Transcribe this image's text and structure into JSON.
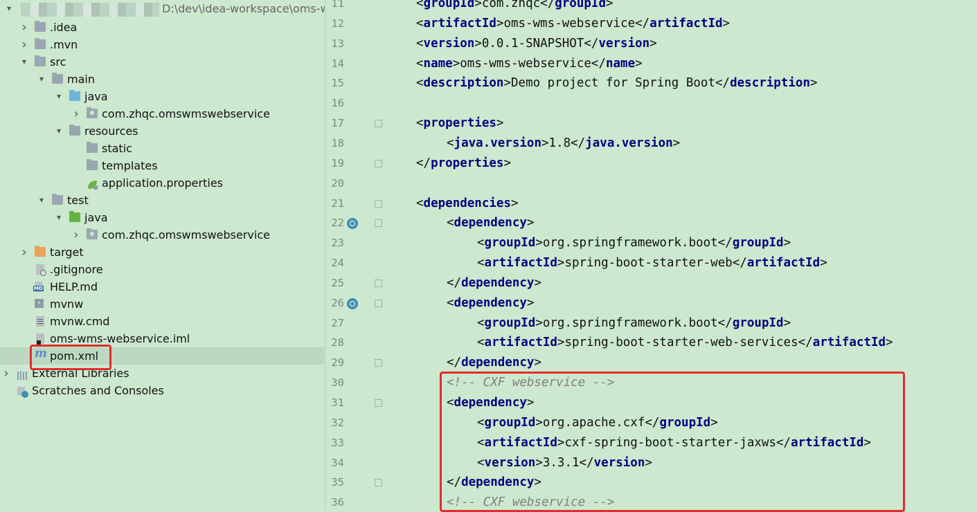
{
  "project": {
    "path_suffix": "D:\\dev\\idea-workspace\\oms-w",
    "tree": [
      {
        "label": ".idea",
        "indent": 0,
        "arrow": "right",
        "icon": "folder"
      },
      {
        "label": ".mvn",
        "indent": 0,
        "arrow": "right",
        "icon": "folder"
      },
      {
        "label": "src",
        "indent": 0,
        "arrow": "down",
        "icon": "folder"
      },
      {
        "label": "main",
        "indent": 1,
        "arrow": "down",
        "icon": "folder"
      },
      {
        "label": "java",
        "indent": 2,
        "arrow": "down",
        "icon": "folder-blue"
      },
      {
        "label": "com.zhqc.omswmswebservice",
        "indent": 3,
        "arrow": "right",
        "icon": "package"
      },
      {
        "label": "resources",
        "indent": 2,
        "arrow": "down",
        "icon": "folder-resources"
      },
      {
        "label": "static",
        "indent": 3,
        "arrow": "none",
        "icon": "folder"
      },
      {
        "label": "templates",
        "indent": 3,
        "arrow": "none",
        "icon": "folder"
      },
      {
        "label": "application.properties",
        "indent": 3,
        "arrow": "none",
        "icon": "spring-leaf"
      },
      {
        "label": "test",
        "indent": 1,
        "arrow": "down",
        "icon": "folder"
      },
      {
        "label": "java",
        "indent": 2,
        "arrow": "down",
        "icon": "folder-green"
      },
      {
        "label": "com.zhqc.omswmswebservice",
        "indent": 3,
        "arrow": "right",
        "icon": "package"
      },
      {
        "label": "target",
        "indent": 0,
        "arrow": "right",
        "icon": "folder-orange"
      },
      {
        "label": ".gitignore",
        "indent": 0,
        "arrow": "none",
        "icon": "file"
      },
      {
        "label": "HELP.md",
        "indent": 0,
        "arrow": "none",
        "icon": "markdown"
      },
      {
        "label": "mvnw",
        "indent": 0,
        "arrow": "none",
        "icon": "terminal"
      },
      {
        "label": "mvnw.cmd",
        "indent": 0,
        "arrow": "none",
        "icon": "file-text"
      },
      {
        "label": "oms-wms-webservice.iml",
        "indent": 0,
        "arrow": "none",
        "icon": "module"
      },
      {
        "label": "pom.xml",
        "indent": 0,
        "arrow": "none",
        "icon": "maven",
        "selected": true
      },
      {
        "label": "External Libraries",
        "indent": -1,
        "arrow": "right",
        "icon": "libraries"
      },
      {
        "label": "Scratches and Consoles",
        "indent": -1,
        "arrow": "none",
        "icon": "scratches"
      }
    ]
  },
  "editor": {
    "lines": [
      {
        "n": "11",
        "indent": 0,
        "parts": [
          [
            "tag",
            "<"
          ],
          [
            "tn",
            "groupId"
          ],
          [
            "tag",
            ">"
          ],
          [
            "txt",
            "com.zhqc"
          ],
          [
            "tag",
            "</"
          ],
          [
            "tn",
            "groupId"
          ],
          [
            "tag",
            ">"
          ]
        ]
      },
      {
        "n": "12",
        "indent": 0,
        "parts": [
          [
            "tag",
            "<"
          ],
          [
            "tn",
            "artifactId"
          ],
          [
            "tag",
            ">"
          ],
          [
            "txt",
            "oms-wms-webservice"
          ],
          [
            "tag",
            "</"
          ],
          [
            "tn",
            "artifactId"
          ],
          [
            "tag",
            ">"
          ]
        ]
      },
      {
        "n": "13",
        "indent": 0,
        "parts": [
          [
            "tag",
            "<"
          ],
          [
            "tn",
            "version"
          ],
          [
            "tag",
            ">"
          ],
          [
            "txt",
            "0.0.1-SNAPSHOT"
          ],
          [
            "tag",
            "</"
          ],
          [
            "tn",
            "version"
          ],
          [
            "tag",
            ">"
          ]
        ]
      },
      {
        "n": "14",
        "indent": 0,
        "parts": [
          [
            "tag",
            "<"
          ],
          [
            "tn",
            "name"
          ],
          [
            "tag",
            ">"
          ],
          [
            "txt",
            "oms-wms-webservice"
          ],
          [
            "tag",
            "</"
          ],
          [
            "tn",
            "name"
          ],
          [
            "tag",
            ">"
          ]
        ]
      },
      {
        "n": "15",
        "indent": 0,
        "parts": [
          [
            "tag",
            "<"
          ],
          [
            "tn",
            "description"
          ],
          [
            "tag",
            ">"
          ],
          [
            "txt",
            "Demo project for Spring Boot"
          ],
          [
            "tag",
            "</"
          ],
          [
            "tn",
            "description"
          ],
          [
            "tag",
            ">"
          ]
        ]
      },
      {
        "n": "16",
        "indent": 0,
        "parts": []
      },
      {
        "n": "17",
        "indent": 0,
        "parts": [
          [
            "tag",
            "<"
          ],
          [
            "tn",
            "properties"
          ],
          [
            "tag",
            ">"
          ]
        ],
        "fold": true
      },
      {
        "n": "18",
        "indent": 1,
        "parts": [
          [
            "tag",
            "<"
          ],
          [
            "tn",
            "java.version"
          ],
          [
            "tag",
            ">"
          ],
          [
            "txt",
            "1.8"
          ],
          [
            "tag",
            "</"
          ],
          [
            "tn",
            "java.version"
          ],
          [
            "tag",
            ">"
          ]
        ]
      },
      {
        "n": "19",
        "indent": 0,
        "parts": [
          [
            "tag",
            "</"
          ],
          [
            "tn",
            "properties"
          ],
          [
            "tag",
            ">"
          ]
        ],
        "fold": true
      },
      {
        "n": "20",
        "indent": 0,
        "parts": []
      },
      {
        "n": "21",
        "indent": 0,
        "parts": [
          [
            "tag",
            "<"
          ],
          [
            "tn",
            "dependencies"
          ],
          [
            "tag",
            ">"
          ]
        ],
        "fold": true
      },
      {
        "n": "22",
        "indent": 1,
        "parts": [
          [
            "tag",
            "<"
          ],
          [
            "tn",
            "dependency"
          ],
          [
            "tag",
            ">"
          ]
        ],
        "gutter": true,
        "fold": true
      },
      {
        "n": "23",
        "indent": 2,
        "parts": [
          [
            "tag",
            "<"
          ],
          [
            "tn",
            "groupId"
          ],
          [
            "tag",
            ">"
          ],
          [
            "txt",
            "org.springframework.boot"
          ],
          [
            "tag",
            "</"
          ],
          [
            "tn",
            "groupId"
          ],
          [
            "tag",
            ">"
          ]
        ]
      },
      {
        "n": "24",
        "indent": 2,
        "parts": [
          [
            "tag",
            "<"
          ],
          [
            "tn",
            "artifactId"
          ],
          [
            "tag",
            ">"
          ],
          [
            "txt",
            "spring-boot-starter-web"
          ],
          [
            "tag",
            "</"
          ],
          [
            "tn",
            "artifactId"
          ],
          [
            "tag",
            ">"
          ]
        ]
      },
      {
        "n": "25",
        "indent": 1,
        "parts": [
          [
            "tag",
            "</"
          ],
          [
            "tn",
            "dependency"
          ],
          [
            "tag",
            ">"
          ]
        ],
        "fold": true
      },
      {
        "n": "26",
        "indent": 1,
        "parts": [
          [
            "tag",
            "<"
          ],
          [
            "tn",
            "dependency"
          ],
          [
            "tag",
            ">"
          ]
        ],
        "gutter": true,
        "fold": true
      },
      {
        "n": "27",
        "indent": 2,
        "parts": [
          [
            "tag",
            "<"
          ],
          [
            "tn",
            "groupId"
          ],
          [
            "tag",
            ">"
          ],
          [
            "txt",
            "org.springframework.boot"
          ],
          [
            "tag",
            "</"
          ],
          [
            "tn",
            "groupId"
          ],
          [
            "tag",
            ">"
          ]
        ]
      },
      {
        "n": "28",
        "indent": 2,
        "parts": [
          [
            "tag",
            "<"
          ],
          [
            "tn",
            "artifactId"
          ],
          [
            "tag",
            ">"
          ],
          [
            "txt",
            "spring-boot-starter-web-services"
          ],
          [
            "tag",
            "</"
          ],
          [
            "tn",
            "artifactId"
          ],
          [
            "tag",
            ">"
          ]
        ]
      },
      {
        "n": "29",
        "indent": 1,
        "parts": [
          [
            "tag",
            "</"
          ],
          [
            "tn",
            "dependency"
          ],
          [
            "tag",
            ">"
          ]
        ],
        "fold": true
      },
      {
        "n": "30",
        "indent": 1,
        "parts": [
          [
            "cmt",
            "<!-- CXF webservice -->"
          ]
        ]
      },
      {
        "n": "31",
        "indent": 1,
        "parts": [
          [
            "tag",
            "<"
          ],
          [
            "tn",
            "dependency"
          ],
          [
            "tag",
            ">"
          ]
        ],
        "fold": true
      },
      {
        "n": "32",
        "indent": 2,
        "parts": [
          [
            "tag",
            "<"
          ],
          [
            "tn",
            "groupId"
          ],
          [
            "tag",
            ">"
          ],
          [
            "txt",
            "org.apache.cxf"
          ],
          [
            "tag",
            "</"
          ],
          [
            "tn",
            "groupId"
          ],
          [
            "tag",
            ">"
          ]
        ]
      },
      {
        "n": "33",
        "indent": 2,
        "parts": [
          [
            "tag",
            "<"
          ],
          [
            "tn",
            "artifactId"
          ],
          [
            "tag",
            ">"
          ],
          [
            "txt",
            "cxf-spring-boot-starter-jaxws"
          ],
          [
            "tag",
            "</"
          ],
          [
            "tn",
            "artifactId"
          ],
          [
            "tag",
            ">"
          ]
        ]
      },
      {
        "n": "34",
        "indent": 2,
        "parts": [
          [
            "tag",
            "<"
          ],
          [
            "tn",
            "version"
          ],
          [
            "tag",
            ">"
          ],
          [
            "txt",
            "3.3.1"
          ],
          [
            "tag",
            "</"
          ],
          [
            "tn",
            "version"
          ],
          [
            "tag",
            ">"
          ]
        ]
      },
      {
        "n": "35",
        "indent": 1,
        "parts": [
          [
            "tag",
            "</"
          ],
          [
            "tn",
            "dependency"
          ],
          [
            "tag",
            ">"
          ]
        ],
        "fold": true
      },
      {
        "n": "36",
        "indent": 1,
        "parts": [
          [
            "cmt",
            "<!-- CXF webservice -->"
          ]
        ]
      }
    ]
  },
  "colors": {
    "background": "#CCE8CF",
    "tag_name": "#000080",
    "comment": "#808080",
    "highlight": "#E32B2B"
  }
}
